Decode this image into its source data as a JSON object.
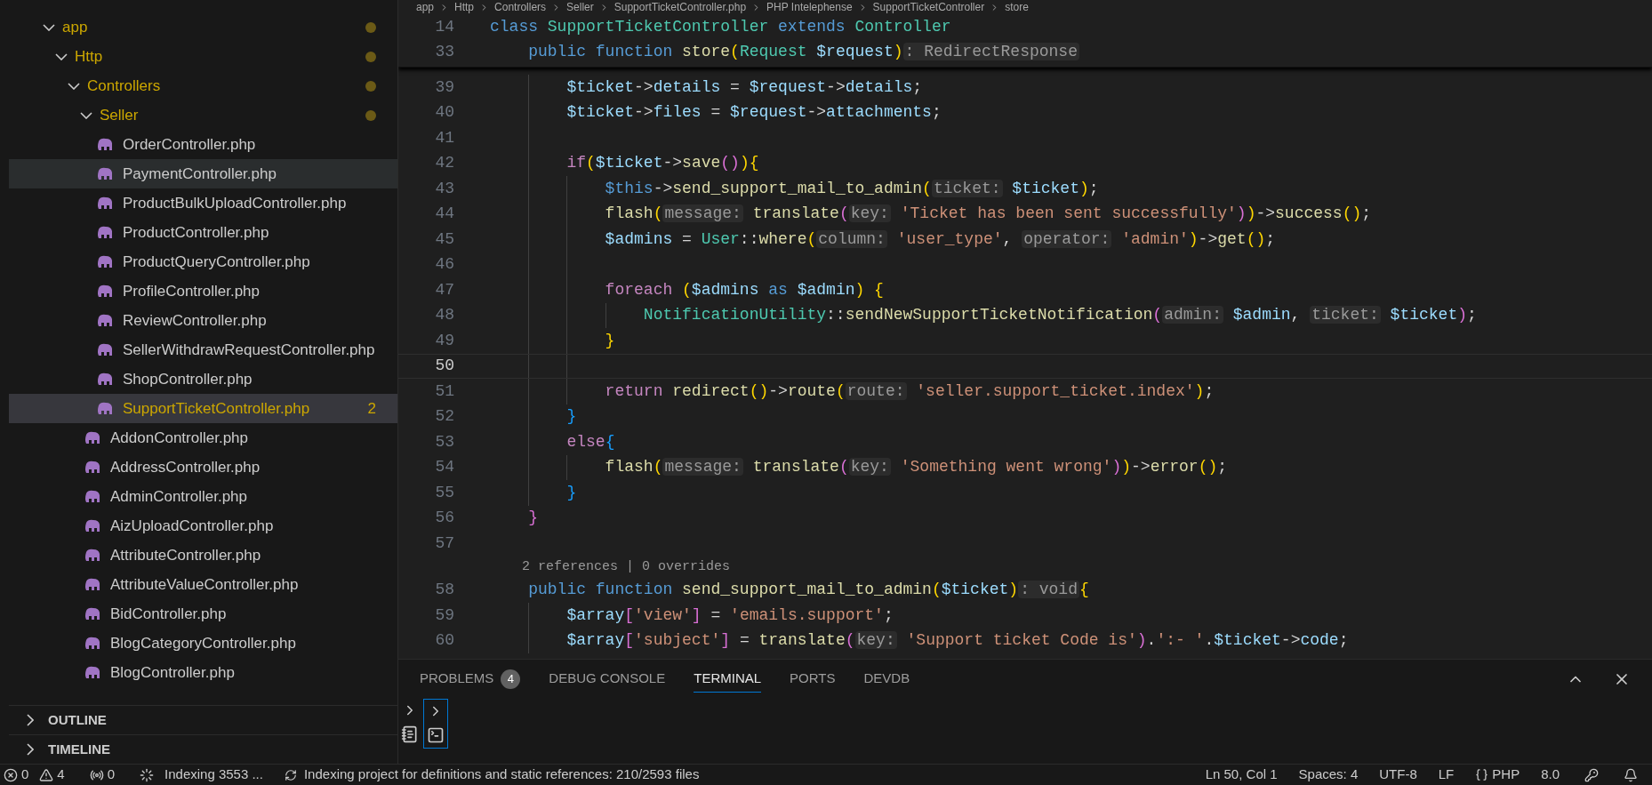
{
  "sidebar": {
    "tree": [
      {
        "label": "app",
        "kind": "folder",
        "expanded": true,
        "modified": true,
        "children": [
          {
            "label": "Http",
            "kind": "folder",
            "expanded": true,
            "modified": true,
            "children": [
              {
                "label": "Controllers",
                "kind": "folder",
                "expanded": true,
                "modified": true,
                "children": [
                  {
                    "label": "Seller",
                    "kind": "folder",
                    "expanded": true,
                    "modified": true,
                    "children": [
                      {
                        "label": "OrderController.php",
                        "kind": "file",
                        "selected": false,
                        "hovered": false,
                        "modified": false
                      },
                      {
                        "label": "PaymentController.php",
                        "kind": "file",
                        "selected": false,
                        "hovered": true,
                        "modified": false
                      },
                      {
                        "label": "ProductBulkUploadController.php",
                        "kind": "file",
                        "selected": false,
                        "hovered": false,
                        "modified": false
                      },
                      {
                        "label": "ProductController.php",
                        "kind": "file",
                        "selected": false,
                        "hovered": false,
                        "modified": false
                      },
                      {
                        "label": "ProductQueryController.php",
                        "kind": "file",
                        "selected": false,
                        "hovered": false,
                        "modified": false
                      },
                      {
                        "label": "ProfileController.php",
                        "kind": "file",
                        "selected": false,
                        "hovered": false,
                        "modified": false
                      },
                      {
                        "label": "ReviewController.php",
                        "kind": "file",
                        "selected": false,
                        "hovered": false,
                        "modified": false
                      },
                      {
                        "label": "SellerWithdrawRequestController.php",
                        "kind": "file",
                        "selected": false,
                        "hovered": false,
                        "modified": false
                      },
                      {
                        "label": "ShopController.php",
                        "kind": "file",
                        "selected": false,
                        "hovered": false,
                        "modified": false
                      },
                      {
                        "label": "SupportTicketController.php",
                        "kind": "file",
                        "selected": true,
                        "hovered": false,
                        "modified": true,
                        "problems": "2"
                      }
                    ]
                  },
                  {
                    "label": "AddonController.php",
                    "kind": "file",
                    "selected": false,
                    "hovered": false,
                    "modified": false
                  },
                  {
                    "label": "AddressController.php",
                    "kind": "file",
                    "selected": false,
                    "hovered": false,
                    "modified": false
                  },
                  {
                    "label": "AdminController.php",
                    "kind": "file",
                    "selected": false,
                    "hovered": false,
                    "modified": false
                  },
                  {
                    "label": "AizUploadController.php",
                    "kind": "file",
                    "selected": false,
                    "hovered": false,
                    "modified": false
                  },
                  {
                    "label": "AttributeController.php",
                    "kind": "file",
                    "selected": false,
                    "hovered": false,
                    "modified": false
                  },
                  {
                    "label": "AttributeValueController.php",
                    "kind": "file",
                    "selected": false,
                    "hovered": false,
                    "modified": false
                  },
                  {
                    "label": "BidController.php",
                    "kind": "file",
                    "selected": false,
                    "hovered": false,
                    "modified": false
                  },
                  {
                    "label": "BlogCategoryController.php",
                    "kind": "file",
                    "selected": false,
                    "hovered": false,
                    "modified": false
                  },
                  {
                    "label": "BlogController.php",
                    "kind": "file",
                    "selected": false,
                    "hovered": false,
                    "modified": false
                  }
                ]
              }
            ]
          }
        ]
      }
    ],
    "sections": [
      {
        "label": "OUTLINE",
        "expanded": false
      },
      {
        "label": "TIMELINE",
        "expanded": false
      }
    ]
  },
  "breadcrumb": [
    "app",
    "Http",
    "Controllers",
    "Seller",
    "SupportTicketController.php",
    "PHP Intelephense",
    "SupportTicketController",
    "store"
  ],
  "editor": {
    "sticky_lines": [
      {
        "number": "14",
        "tokens": [
          {
            "text": "class ",
            "kind": "storage"
          },
          {
            "text": "SupportTicketController ",
            "kind": "cls"
          },
          {
            "text": "extends ",
            "kind": "storage"
          },
          {
            "text": "Controller",
            "kind": "cls"
          }
        ]
      },
      {
        "number": "33",
        "tokens": [
          {
            "text": "    public function ",
            "kind": "storage"
          },
          {
            "text": "store",
            "kind": "fn"
          },
          {
            "text": "(",
            "kind": "b1"
          },
          {
            "text": "Request ",
            "kind": "cls"
          },
          {
            "text": "$request",
            "kind": "var"
          },
          {
            "text": ")",
            "kind": "b1"
          },
          {
            "text": ": RedirectResponse",
            "kind": "hint"
          }
        ]
      }
    ],
    "lines": [
      {
        "number": "39",
        "current": false,
        "tokens": [
          {
            "text": "        $ticket",
            "kind": "var"
          },
          {
            "text": "->"
          },
          {
            "text": "details",
            "kind": "var"
          },
          {
            "text": " = "
          },
          {
            "text": "$request",
            "kind": "var"
          },
          {
            "text": "->"
          },
          {
            "text": "details",
            "kind": "var"
          },
          {
            "text": ";"
          }
        ]
      },
      {
        "number": "40",
        "current": false,
        "tokens": [
          {
            "text": "        $ticket",
            "kind": "var"
          },
          {
            "text": "->"
          },
          {
            "text": "files",
            "kind": "var"
          },
          {
            "text": " = "
          },
          {
            "text": "$request",
            "kind": "var"
          },
          {
            "text": "->"
          },
          {
            "text": "attachments",
            "kind": "var"
          },
          {
            "text": ";"
          }
        ]
      },
      {
        "number": "41",
        "current": false
      },
      {
        "number": "42",
        "current": false,
        "tokens": [
          {
            "text": "        if",
            "kind": "ctrl"
          },
          {
            "text": "(",
            "kind": "b1"
          },
          {
            "text": "$ticket",
            "kind": "var"
          },
          {
            "text": "->"
          },
          {
            "text": "save",
            "kind": "fn"
          },
          {
            "text": "()",
            "kind": "b2"
          },
          {
            "text": ")",
            "kind": "b1"
          },
          {
            "text": "{",
            "kind": "b1"
          }
        ]
      },
      {
        "number": "43",
        "current": false,
        "tokens": [
          {
            "text": "            $this",
            "kind": "storage"
          },
          {
            "text": "->"
          },
          {
            "text": "send_support_mail_to_admin",
            "kind": "fn"
          },
          {
            "text": "(",
            "kind": "b1"
          },
          {
            "text": "ticket:",
            "kind": "hint"
          },
          {
            "text": " $ticket",
            "kind": "var"
          },
          {
            "text": ")",
            "kind": "b1"
          },
          {
            "text": ";"
          }
        ]
      },
      {
        "number": "44",
        "current": false,
        "tokens": [
          {
            "text": "            flash",
            "kind": "fn"
          },
          {
            "text": "(",
            "kind": "b1"
          },
          {
            "text": "message:",
            "kind": "hint"
          },
          {
            "text": " translate",
            "kind": "fn"
          },
          {
            "text": "(",
            "kind": "b2"
          },
          {
            "text": "key:",
            "kind": "hint"
          },
          {
            "text": " 'Ticket has been sent successfully'",
            "kind": "str"
          },
          {
            "text": ")",
            "kind": "b2"
          },
          {
            "text": ")",
            "kind": "b1"
          },
          {
            "text": "->"
          },
          {
            "text": "success",
            "kind": "fn"
          },
          {
            "text": "()",
            "kind": "b1"
          },
          {
            "text": ";"
          }
        ]
      },
      {
        "number": "45",
        "current": false,
        "tokens": [
          {
            "text": "            $admins",
            "kind": "var"
          },
          {
            "text": " = "
          },
          {
            "text": "User",
            "kind": "cls"
          },
          {
            "text": "::"
          },
          {
            "text": "where",
            "kind": "fn"
          },
          {
            "text": "(",
            "kind": "b1"
          },
          {
            "text": "column:",
            "kind": "hint"
          },
          {
            "text": " 'user_type'",
            "kind": "str"
          },
          {
            "text": ", "
          },
          {
            "text": "operator:",
            "kind": "hint"
          },
          {
            "text": " 'admin'",
            "kind": "str"
          },
          {
            "text": ")",
            "kind": "b1"
          },
          {
            "text": "->"
          },
          {
            "text": "get",
            "kind": "fn"
          },
          {
            "text": "()",
            "kind": "b1"
          },
          {
            "text": ";"
          }
        ]
      },
      {
        "number": "46",
        "current": false
      },
      {
        "number": "47",
        "current": false,
        "tokens": [
          {
            "text": "            foreach ",
            "kind": "ctrl"
          },
          {
            "text": "(",
            "kind": "b1"
          },
          {
            "text": "$admins ",
            "kind": "var"
          },
          {
            "text": "as ",
            "kind": "storage"
          },
          {
            "text": "$admin",
            "kind": "var"
          },
          {
            "text": ")",
            "kind": "b1"
          },
          {
            "text": " {",
            "kind": "b1"
          }
        ]
      },
      {
        "number": "48",
        "current": false,
        "tokens": [
          {
            "text": "                NotificationUtility",
            "kind": "cls"
          },
          {
            "text": "::"
          },
          {
            "text": "sendNewSupportTicketNotification",
            "kind": "fn"
          },
          {
            "text": "(",
            "kind": "b2"
          },
          {
            "text": "admin:",
            "kind": "hint"
          },
          {
            "text": " $admin",
            "kind": "var"
          },
          {
            "text": ", "
          },
          {
            "text": "ticket:",
            "kind": "hint"
          },
          {
            "text": " $ticket",
            "kind": "var"
          },
          {
            "text": ")",
            "kind": "b2"
          },
          {
            "text": ";"
          }
        ]
      },
      {
        "number": "49",
        "current": false,
        "tokens": [
          {
            "text": "            }",
            "kind": "b1"
          }
        ]
      },
      {
        "number": "50",
        "current": true
      },
      {
        "number": "51",
        "current": false,
        "tokens": [
          {
            "text": "            return ",
            "kind": "ctrl"
          },
          {
            "text": "redirect",
            "kind": "fn"
          },
          {
            "text": "()",
            "kind": "b1"
          },
          {
            "text": "->"
          },
          {
            "text": "route",
            "kind": "fn"
          },
          {
            "text": "(",
            "kind": "b1"
          },
          {
            "text": "route:",
            "kind": "hint"
          },
          {
            "text": " 'seller.support_ticket.index'",
            "kind": "str"
          },
          {
            "text": ")",
            "kind": "b1"
          },
          {
            "text": ";"
          }
        ]
      },
      {
        "number": "52",
        "current": false,
        "tokens": [
          {
            "text": "        }",
            "kind": "b3"
          }
        ]
      },
      {
        "number": "53",
        "current": false,
        "tokens": [
          {
            "text": "        else",
            "kind": "ctrl"
          },
          {
            "text": "{",
            "kind": "b3"
          }
        ]
      },
      {
        "number": "54",
        "current": false,
        "tokens": [
          {
            "text": "            flash",
            "kind": "fn"
          },
          {
            "text": "(",
            "kind": "b1"
          },
          {
            "text": "message:",
            "kind": "hint"
          },
          {
            "text": " translate",
            "kind": "fn"
          },
          {
            "text": "(",
            "kind": "b2"
          },
          {
            "text": "key:",
            "kind": "hint"
          },
          {
            "text": " 'Something went wrong'",
            "kind": "str"
          },
          {
            "text": ")",
            "kind": "b2"
          },
          {
            "text": ")",
            "kind": "b1"
          },
          {
            "text": "->"
          },
          {
            "text": "error",
            "kind": "fn"
          },
          {
            "text": "()",
            "kind": "b1"
          },
          {
            "text": ";"
          }
        ]
      },
      {
        "number": "55",
        "current": false,
        "tokens": [
          {
            "text": "        }",
            "kind": "b3"
          }
        ]
      },
      {
        "number": "56",
        "current": false,
        "tokens": [
          {
            "text": "    }",
            "kind": "b2"
          }
        ]
      },
      {
        "number": "57",
        "current": false
      },
      {
        "kind": "codelens",
        "text": "    2 references | 0 overrides"
      },
      {
        "number": "58",
        "current": false,
        "tokens": [
          {
            "text": "    public function ",
            "kind": "storage"
          },
          {
            "text": "send_support_mail_to_admin",
            "kind": "fn"
          },
          {
            "text": "(",
            "kind": "b1"
          },
          {
            "text": "$ticket",
            "kind": "var"
          },
          {
            "text": ")",
            "kind": "b1"
          },
          {
            "text": ": void",
            "kind": "hint"
          },
          {
            "text": "{",
            "kind": "b1"
          }
        ]
      },
      {
        "number": "59",
        "current": false,
        "tokens": [
          {
            "text": "        $array",
            "kind": "var"
          },
          {
            "text": "[",
            "kind": "b2"
          },
          {
            "text": "'view'",
            "kind": "str"
          },
          {
            "text": "]",
            "kind": "b2"
          },
          {
            "text": " = "
          },
          {
            "text": "'emails.support'",
            "kind": "str"
          },
          {
            "text": ";"
          }
        ]
      },
      {
        "number": "60",
        "current": false,
        "tokens": [
          {
            "text": "        $array",
            "kind": "var"
          },
          {
            "text": "[",
            "kind": "b2"
          },
          {
            "text": "'subject'",
            "kind": "str"
          },
          {
            "text": "]",
            "kind": "b2"
          },
          {
            "text": " = "
          },
          {
            "text": "translate",
            "kind": "fn"
          },
          {
            "text": "(",
            "kind": "b2"
          },
          {
            "text": "key:",
            "kind": "hint"
          },
          {
            "text": " 'Support ticket Code is'",
            "kind": "str"
          },
          {
            "text": ")",
            "kind": "b2"
          },
          {
            "text": "."
          },
          {
            "text": "':- '",
            "kind": "str"
          },
          {
            "text": "."
          },
          {
            "text": "$ticket",
            "kind": "var"
          },
          {
            "text": "->"
          },
          {
            "text": "code",
            "kind": "var"
          },
          {
            "text": ";"
          }
        ]
      }
    ]
  },
  "panel": {
    "tabs": [
      {
        "label": "PROBLEMS",
        "badge": "4",
        "selected": false
      },
      {
        "label": "DEBUG CONSOLE",
        "selected": false
      },
      {
        "label": "TERMINAL",
        "selected": true
      },
      {
        "label": "PORTS",
        "selected": false
      },
      {
        "label": "DEVDB",
        "selected": false
      }
    ]
  },
  "status_bar": {
    "errors": "0",
    "warnings": "4",
    "ports": "0",
    "indexing": "Indexing 3553 ...",
    "progress": "Indexing project for definitions and static references: 210/2593 files",
    "position": "Ln 50, Col 1",
    "spaces": "Spaces: 4",
    "encoding": "UTF-8",
    "eol": "LF",
    "language": "PHP",
    "version": "8.0"
  }
}
